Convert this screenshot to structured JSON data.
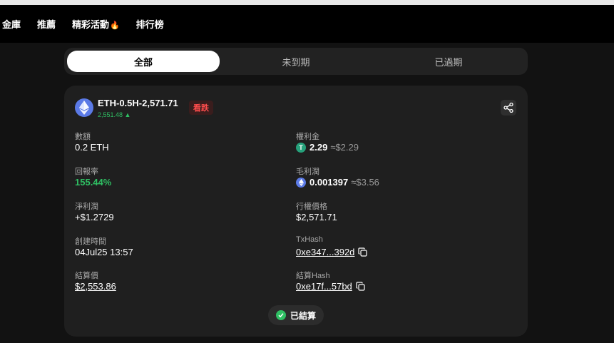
{
  "nav": {
    "items": [
      {
        "label": "金庫"
      },
      {
        "label": "推薦"
      },
      {
        "label": "精彩活動"
      },
      {
        "label": "排行榜"
      }
    ],
    "flame_glyph": "🔥"
  },
  "tabs": [
    {
      "label": "全部",
      "active": true
    },
    {
      "label": "未到期",
      "active": false
    },
    {
      "label": "已過期",
      "active": false
    }
  ],
  "card": {
    "title": "ETH-0.5H-2,571.71",
    "current_price": "2,551.48 ▲",
    "direction_badge": "看跌",
    "fields": {
      "amount": {
        "label": "數額",
        "value": "0.2 ETH"
      },
      "premium": {
        "label": "權利金",
        "amount": "2.29",
        "approx": "≈$2.29",
        "coin": "USDT",
        "coin_glyph": "T"
      },
      "return_rate": {
        "label": "回報率",
        "value": "155.44%"
      },
      "gross_profit": {
        "label": "毛利潤",
        "amount": "0.001397",
        "approx": "≈$3.56",
        "coin": "ETH"
      },
      "net_profit": {
        "label": "淨利潤",
        "value": "+$1.2729"
      },
      "strike_price": {
        "label": "行權價格",
        "value": "$2,571.71"
      },
      "created_time": {
        "label": "創建時間",
        "value": "04Jul25 13:57"
      },
      "txhash": {
        "label": "TxHash",
        "value": "0xe347...392d"
      },
      "settlement_price": {
        "label": "結算價",
        "value": "$2,553.86"
      },
      "settlement_hash": {
        "label": "結算Hash",
        "value": "0xe17f...57bd"
      }
    },
    "status": "已結算"
  },
  "colors": {
    "positive": "#2fbf63",
    "negative": "#ff4d4d",
    "eth": "#5b7ae6",
    "usdt": "#26a17b"
  },
  "icons": {
    "share": "share-icon",
    "copy": "copy-icon",
    "check": "check-circle-icon",
    "eth": "eth-logo-icon",
    "flame": "flame-icon"
  }
}
